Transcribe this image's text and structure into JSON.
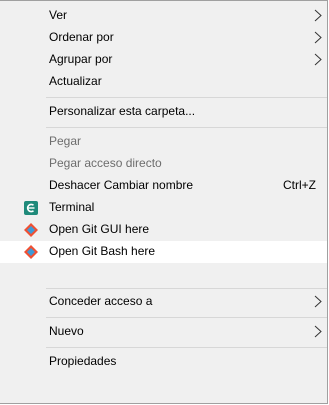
{
  "menu": {
    "items": [
      {
        "label": "Ver"
      },
      {
        "label": "Ordenar por"
      },
      {
        "label": "Agrupar por"
      },
      {
        "label": "Actualizar"
      },
      {
        "label": "Personalizar esta carpeta..."
      },
      {
        "label": "Pegar"
      },
      {
        "label": "Pegar acceso directo"
      },
      {
        "label": "Deshacer Cambiar nombre",
        "shortcut": "Ctrl+Z"
      },
      {
        "label": "Terminal",
        "icon": "terminal-icon"
      },
      {
        "label": "Open Git GUI here",
        "icon": "git-icon"
      },
      {
        "label": "Open Git Bash here",
        "icon": "git-icon"
      },
      {
        "label": "Conceder acceso a"
      },
      {
        "label": "Nuevo"
      },
      {
        "label": "Propiedades"
      }
    ]
  },
  "colors": {
    "menu_bg": "#f0f0f0",
    "hover_bg": "#ffffff",
    "disabled_text": "#6d6d6d",
    "separator": "#d7d7d7",
    "terminal_icon": "#1f8a7a",
    "git_icon_primary": "#f05033",
    "git_icon_secondary": "#3e9bd8"
  }
}
